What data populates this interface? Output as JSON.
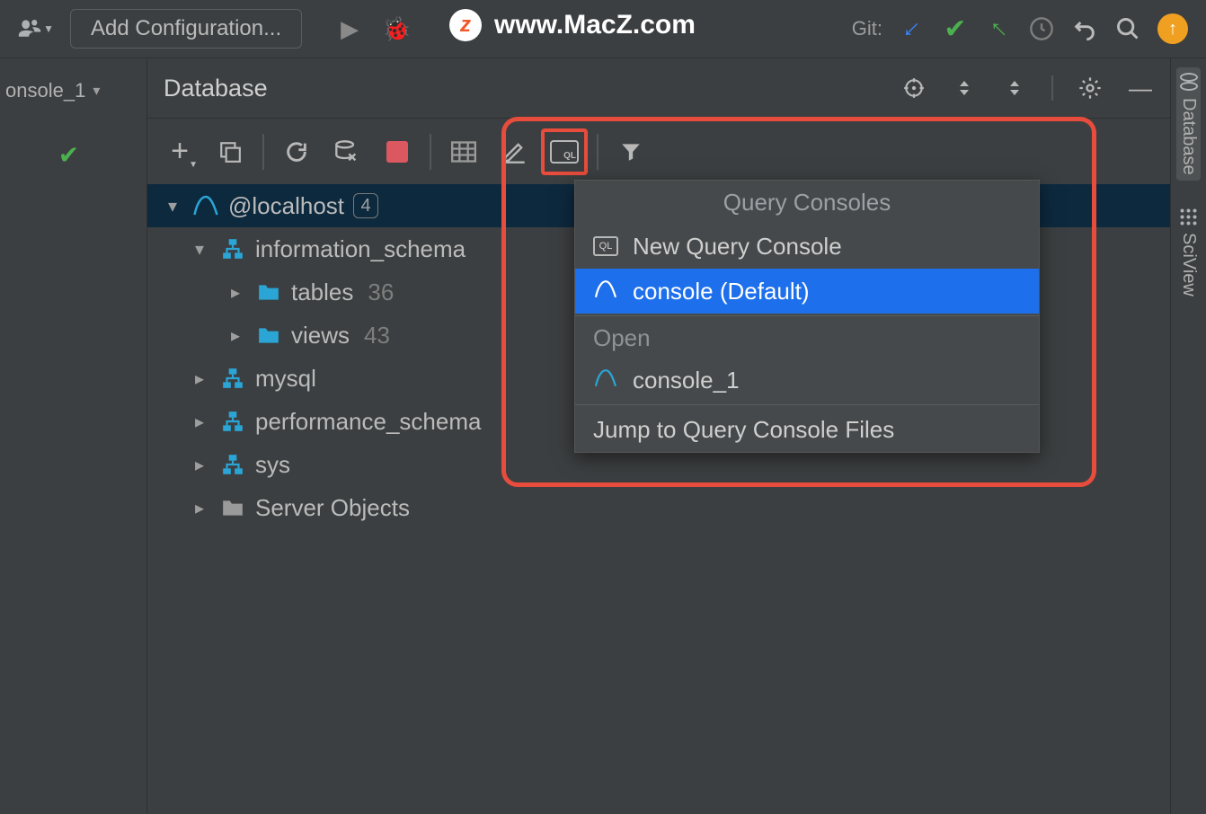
{
  "watermark": "www.MacZ.com",
  "top": {
    "add_config": "Add Configuration...",
    "git_label": "Git:"
  },
  "left": {
    "tab_label": "onsole_1"
  },
  "panel": {
    "title": "Database"
  },
  "tree": {
    "root": {
      "label": "@localhost",
      "count": "4"
    },
    "info_schema": {
      "label": "information_schema"
    },
    "tables": {
      "label": "tables",
      "count": "36"
    },
    "views": {
      "label": "views",
      "count": "43"
    },
    "mysql": {
      "label": "mysql"
    },
    "perf": {
      "label": "performance_schema"
    },
    "sys": {
      "label": "sys"
    },
    "server_objects": {
      "label": "Server Objects"
    }
  },
  "popup": {
    "title": "Query Consoles",
    "new_qc": "New Query Console",
    "default_console": "console (Default)",
    "open_section": "Open",
    "console1": "console_1",
    "jump": "Jump to Query Console Files"
  },
  "rightbar": {
    "database": "Database",
    "sciview": "SciView"
  }
}
